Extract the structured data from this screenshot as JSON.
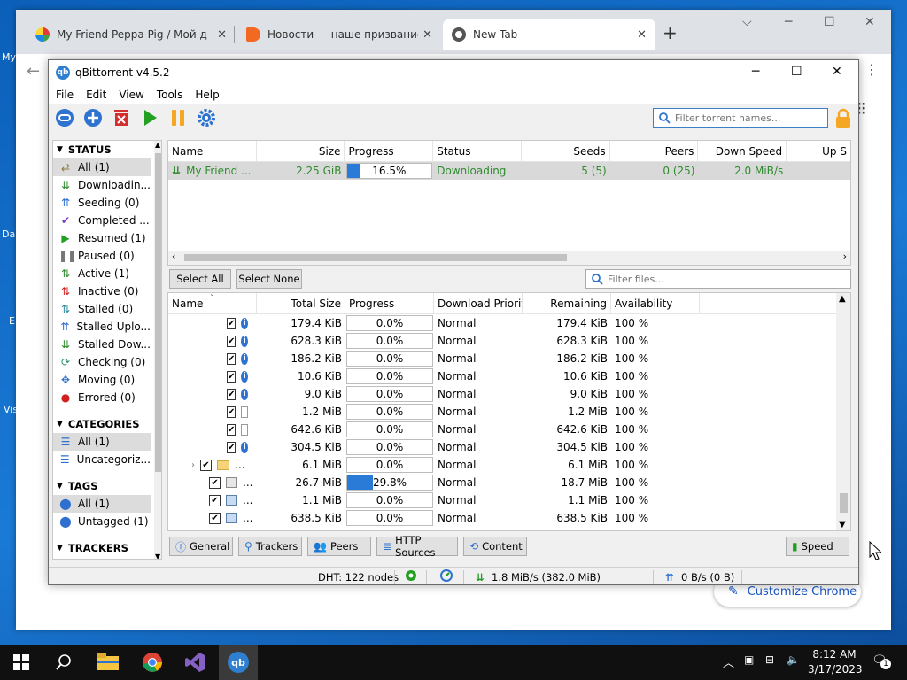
{
  "desktop": {
    "fragments": [
      "My",
      "Da",
      "E",
      "Vis"
    ]
  },
  "browser": {
    "tabs": [
      {
        "label": "My Friend Peppa Pig / Мой друг",
        "active": false
      },
      {
        "label": "Новости — наше призвание на",
        "active": false
      },
      {
        "label": "New Tab",
        "active": true
      }
    ],
    "close_glyph": "✕",
    "new_tab_glyph": "+",
    "customize_label": "Customize Chrome"
  },
  "qb": {
    "title": "qBittorrent v4.5.2",
    "menu": [
      "File",
      "Edit",
      "View",
      "Tools",
      "Help"
    ],
    "filter_placeholder": "Filter torrent names...",
    "sidebar": {
      "status_header": "STATUS",
      "status_items": [
        {
          "label": "All (1)",
          "icon": "filter-all-icon",
          "color": "#8b7a3a",
          "glyph": "⇄",
          "selected": true
        },
        {
          "label": "Downloadin...",
          "icon": "downloading-icon",
          "color": "#2e8b2e",
          "glyph": "⇊",
          "selected": false
        },
        {
          "label": "Seeding (0)",
          "icon": "seeding-icon",
          "color": "#2e6fd0",
          "glyph": "⇈",
          "selected": false
        },
        {
          "label": "Completed ...",
          "icon": "completed-icon",
          "color": "#7a3fc0",
          "glyph": "✔",
          "selected": false
        },
        {
          "label": "Resumed (1)",
          "icon": "resumed-icon",
          "color": "#22a022",
          "glyph": "▶",
          "selected": false
        },
        {
          "label": "Paused (0)",
          "icon": "paused-icon",
          "color": "#777777",
          "glyph": "❚❚",
          "selected": false
        },
        {
          "label": "Active (1)",
          "icon": "active-icon",
          "color": "#2e8b2e",
          "glyph": "⇅",
          "selected": false
        },
        {
          "label": "Inactive (0)",
          "icon": "inactive-icon",
          "color": "#d02020",
          "glyph": "⇅",
          "selected": false
        },
        {
          "label": "Stalled (0)",
          "icon": "stalled-icon",
          "color": "#2e8b9e",
          "glyph": "⇅",
          "selected": false
        },
        {
          "label": "Stalled Uplo...",
          "icon": "stalled-upload-icon",
          "color": "#2e6fd0",
          "glyph": "⇈",
          "selected": false
        },
        {
          "label": "Stalled Dow...",
          "icon": "stalled-download-icon",
          "color": "#2e8b2e",
          "glyph": "⇊",
          "selected": false
        },
        {
          "label": "Checking (0)",
          "icon": "checking-icon",
          "color": "#2e8b6e",
          "glyph": "⟳",
          "selected": false
        },
        {
          "label": "Moving (0)",
          "icon": "moving-icon",
          "color": "#2e6fd0",
          "glyph": "✥",
          "selected": false
        },
        {
          "label": "Errored (0)",
          "icon": "errored-icon",
          "color": "#d02020",
          "glyph": "●",
          "selected": false
        }
      ],
      "categories_header": "CATEGORIES",
      "category_items": [
        {
          "label": "All (1)",
          "icon": "category-all-icon",
          "color": "#2e6fd0",
          "glyph": "☰",
          "selected": true
        },
        {
          "label": "Uncategoriz...",
          "icon": "uncategorized-icon",
          "color": "#2e6fd0",
          "glyph": "☰",
          "selected": false
        }
      ],
      "tags_header": "TAGS",
      "tag_items": [
        {
          "label": "All (1)",
          "icon": "tag-all-icon",
          "color": "#2e6fd0",
          "glyph": "⬤",
          "selected": true
        },
        {
          "label": "Untagged (1)",
          "icon": "untagged-icon",
          "color": "#2e6fd0",
          "glyph": "⬤",
          "selected": false
        }
      ],
      "trackers_header": "TRACKERS"
    },
    "torrents": {
      "columns": [
        "Name",
        "Size",
        "Progress",
        "Status",
        "Seeds",
        "Peers",
        "Down Speed",
        "Up S"
      ],
      "rows": [
        {
          "name": "My Friend ...",
          "size": "2.25 GiB",
          "progress": 16.5,
          "progress_label": "16.5%",
          "status": "Downloading",
          "seeds": "5 (5)",
          "peers": "0 (25)",
          "down": "2.0 MiB/s"
        }
      ]
    },
    "select_all": "Select All",
    "select_none": "Select None",
    "files_filter_placeholder": "Filter files...",
    "files": {
      "columns": [
        "Name",
        "Total Size",
        "Progress",
        "Download Priority",
        "Remaining",
        "Availability"
      ],
      "rows": [
        {
          "icon": "info",
          "name": "",
          "expander": false,
          "size": "179.4 KiB",
          "progress": 0.0,
          "progress_label": "0.0%",
          "priority": "Normal",
          "remaining": "179.4 KiB",
          "availability": "100 %"
        },
        {
          "icon": "info",
          "name": "",
          "expander": false,
          "size": "628.3 KiB",
          "progress": 0.0,
          "progress_label": "0.0%",
          "priority": "Normal",
          "remaining": "628.3 KiB",
          "availability": "100 %"
        },
        {
          "icon": "info",
          "name": "",
          "expander": false,
          "size": "186.2 KiB",
          "progress": 0.0,
          "progress_label": "0.0%",
          "priority": "Normal",
          "remaining": "186.2 KiB",
          "availability": "100 %"
        },
        {
          "icon": "info",
          "name": "",
          "expander": false,
          "size": "10.6 KiB",
          "progress": 0.0,
          "progress_label": "0.0%",
          "priority": "Normal",
          "remaining": "10.6 KiB",
          "availability": "100 %"
        },
        {
          "icon": "info",
          "name": "",
          "expander": false,
          "size": "9.0 KiB",
          "progress": 0.0,
          "progress_label": "0.0%",
          "priority": "Normal",
          "remaining": "9.0 KiB",
          "availability": "100 %"
        },
        {
          "icon": "doc",
          "name": "",
          "expander": false,
          "size": "1.2 MiB",
          "progress": 0.0,
          "progress_label": "0.0%",
          "priority": "Normal",
          "remaining": "1.2 MiB",
          "availability": "100 %"
        },
        {
          "icon": "doc",
          "name": "",
          "expander": false,
          "size": "642.6 KiB",
          "progress": 0.0,
          "progress_label": "0.0%",
          "priority": "Normal",
          "remaining": "642.6 KiB",
          "availability": "100 %"
        },
        {
          "icon": "info",
          "name": "",
          "expander": false,
          "size": "304.5 KiB",
          "progress": 0.0,
          "progress_label": "0.0%",
          "priority": "Normal",
          "remaining": "304.5 KiB",
          "availability": "100 %"
        },
        {
          "icon": "folder",
          "name": "...",
          "expander": true,
          "size": "6.1 MiB",
          "progress": 0.0,
          "progress_label": "0.0%",
          "priority": "Normal",
          "remaining": "6.1 MiB",
          "availability": "100 %"
        },
        {
          "icon": "image",
          "name": "...",
          "expander": false,
          "size": "26.7 MiB",
          "progress": 29.8,
          "progress_label": "29.8%",
          "priority": "Normal",
          "remaining": "18.7 MiB",
          "availability": "100 %"
        },
        {
          "icon": "media",
          "name": "...",
          "expander": false,
          "size": "1.1 MiB",
          "progress": 0.0,
          "progress_label": "0.0%",
          "priority": "Normal",
          "remaining": "1.1 MiB",
          "availability": "100 %"
        },
        {
          "icon": "media",
          "name": "...",
          "expander": false,
          "size": "638.5 KiB",
          "progress": 0.0,
          "progress_label": "0.0%",
          "priority": "Normal",
          "remaining": "638.5 KiB",
          "availability": "100 %"
        }
      ]
    },
    "bottom_tabs": [
      "General",
      "Trackers",
      "Peers",
      "HTTP Sources",
      "Content"
    ],
    "speed_tab": "Speed",
    "status": {
      "dht": "DHT: 122 nodes",
      "down": "1.8 MiB/s (382.0 MiB)",
      "up": "0 B/s (0 B)"
    }
  },
  "taskbar": {
    "time": "8:12 AM",
    "date": "3/17/2023",
    "notifications": "1"
  },
  "colors": {
    "accent": "#2a7ad8",
    "download_green": "#2e8b2e"
  }
}
